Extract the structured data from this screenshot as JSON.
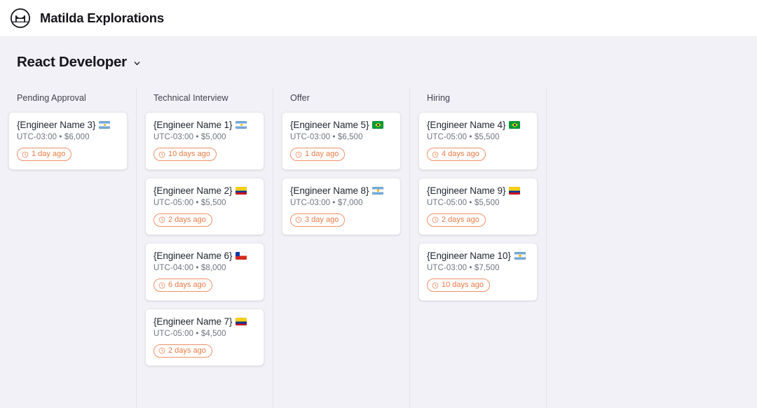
{
  "app": {
    "brand_name": "Matilda Explorations",
    "logo_icon": "matilda-bridge-logo"
  },
  "page": {
    "title": "React Developer",
    "title_chevron_icon": "chevron-down-icon"
  },
  "theme": {
    "page_background": "#f2f1f7",
    "header_background": "#ffffff",
    "card_background": "#ffffff",
    "card_border": "#e9e8ee",
    "column_divider": "#e4e3ea",
    "title_color": "#1f2430",
    "meta_color": "#6e7380",
    "badge_accent": "#e97a44"
  },
  "board": {
    "columns": [
      {
        "title": "Pending Approval",
        "cards": [
          {
            "name": "{Engineer Name 3}",
            "flag": "ar",
            "timezone": "UTC-03:00",
            "separator": "•",
            "rate": "$6,000",
            "meta": "UTC-03:00 • $6,000",
            "age": "1 day ago",
            "age_icon": "clock-icon"
          }
        ]
      },
      {
        "title": "Technical Interview",
        "cards": [
          {
            "name": "{Engineer Name 1}",
            "flag": "ar",
            "timezone": "UTC-03:00",
            "separator": "•",
            "rate": "$5,000",
            "meta": "UTC-03:00 • $5,000",
            "age": "10 days ago",
            "age_icon": "clock-icon"
          },
          {
            "name": "{Engineer Name 2}",
            "flag": "co",
            "timezone": "UTC-05:00",
            "separator": "•",
            "rate": "$5,500",
            "meta": "UTC-05:00 • $5,500",
            "age": "2 days ago",
            "age_icon": "clock-icon"
          },
          {
            "name": "{Engineer Name 6}",
            "flag": "cl",
            "timezone": "UTC-04:00",
            "separator": "•",
            "rate": "$8,000",
            "meta": "UTC-04:00 • $8,000",
            "age": "6 days ago",
            "age_icon": "clock-icon"
          },
          {
            "name": "{Engineer Name 7}",
            "flag": "co",
            "timezone": "UTC-05:00",
            "separator": "•",
            "rate": "$4,500",
            "meta": "UTC-05:00 • $4,500",
            "age": "2 days ago",
            "age_icon": "clock-icon"
          }
        ]
      },
      {
        "title": "Offer",
        "cards": [
          {
            "name": "{Engineer Name 5}",
            "flag": "br",
            "timezone": "UTC-03:00",
            "separator": "•",
            "rate": "$6,500",
            "meta": "UTC-03:00 • $6,500",
            "age": "1 day ago",
            "age_icon": "clock-icon"
          },
          {
            "name": "{Engineer Name 8}",
            "flag": "ar",
            "timezone": "UTC-03:00",
            "separator": "•",
            "rate": "$7,000",
            "meta": "UTC-03:00 • $7,000",
            "age": "3 day ago",
            "age_icon": "clock-icon"
          }
        ]
      },
      {
        "title": "Hiring",
        "cards": [
          {
            "name": "{Engineer Name 4}",
            "flag": "br",
            "timezone": "UTC-05:00",
            "separator": "•",
            "rate": "$5,500",
            "meta": "UTC-05:00 • $5,500",
            "age": "4 days ago",
            "age_icon": "clock-icon"
          },
          {
            "name": "{Engineer Name 9}",
            "flag": "co",
            "timezone": "UTC-05:00",
            "separator": "•",
            "rate": "$5,500",
            "meta": "UTC-05:00 • $5,500",
            "age": "2 days ago",
            "age_icon": "clock-icon"
          },
          {
            "name": "{Engineer Name 10}",
            "flag": "ar",
            "timezone": "UTC-03:00",
            "separator": "•",
            "rate": "$7,500",
            "meta": "UTC-03:00 • $7,500",
            "age": "10 days ago",
            "age_icon": "clock-icon"
          }
        ]
      }
    ]
  }
}
